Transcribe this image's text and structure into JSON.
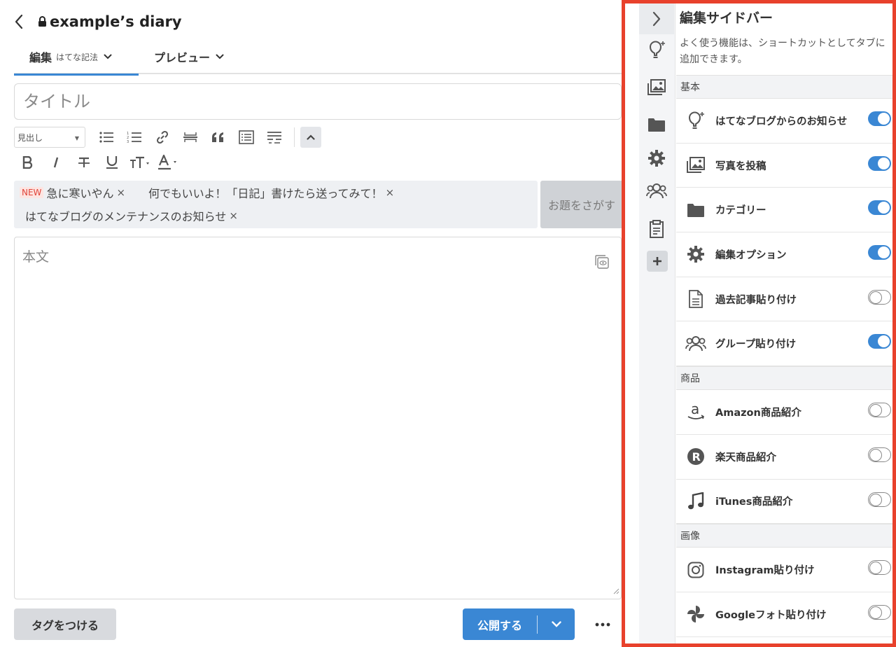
{
  "header": {
    "blog_title": "example’s diary"
  },
  "tabs": {
    "edit_label": "編集",
    "edit_mode": "はてな記法",
    "preview_label": "プレビュー"
  },
  "editor": {
    "title_placeholder": "タイトル",
    "heading_select_value": "見出し",
    "body_placeholder": "本文"
  },
  "topics": {
    "new_badge": "NEW",
    "items": [
      {
        "label": "急に寒いやん"
      },
      {
        "label": "何でもいいよ！「日記」書けたら送ってみて！"
      },
      {
        "label": "はてなブログのメンテナンスのお知らせ"
      }
    ],
    "remove_glyph": "×",
    "find_button": "お題をさがす"
  },
  "footer": {
    "tag_button": "タグをつける",
    "publish_button": "公開する"
  },
  "sidebar": {
    "title": "編集サイドバー",
    "description": "よく使う機能は、ショートカットとしてタブに追加できます。",
    "sections": [
      {
        "label": "基本",
        "items": [
          {
            "label": "はてなブログからのお知らせ",
            "icon": "lightbulb-icon",
            "enabled": true
          },
          {
            "label": "写真を投稿",
            "icon": "photo-icon",
            "enabled": true
          },
          {
            "label": "カテゴリー",
            "icon": "folder-icon",
            "enabled": true
          },
          {
            "label": "編集オプション",
            "icon": "gear-icon",
            "enabled": true
          },
          {
            "label": "過去記事貼り付け",
            "icon": "document-icon",
            "enabled": false
          },
          {
            "label": "グループ貼り付け",
            "icon": "group-icon",
            "enabled": true
          }
        ]
      },
      {
        "label": "商品",
        "items": [
          {
            "label": "Amazon商品紹介",
            "icon": "amazon-icon",
            "enabled": false
          },
          {
            "label": "楽天商品紹介",
            "icon": "rakuten-icon",
            "enabled": false
          },
          {
            "label": "iTunes商品紹介",
            "icon": "music-note-icon",
            "enabled": false
          }
        ]
      },
      {
        "label": "画像",
        "items": [
          {
            "label": "Instagram貼り付け",
            "icon": "instagram-icon",
            "enabled": false
          },
          {
            "label": "Googleフォト貼り付け",
            "icon": "google-photos-icon",
            "enabled": false
          }
        ]
      }
    ]
  },
  "colors": {
    "accent": "#3a87d4",
    "highlight_border": "#e8412c",
    "new_badge": "#e0453a"
  }
}
